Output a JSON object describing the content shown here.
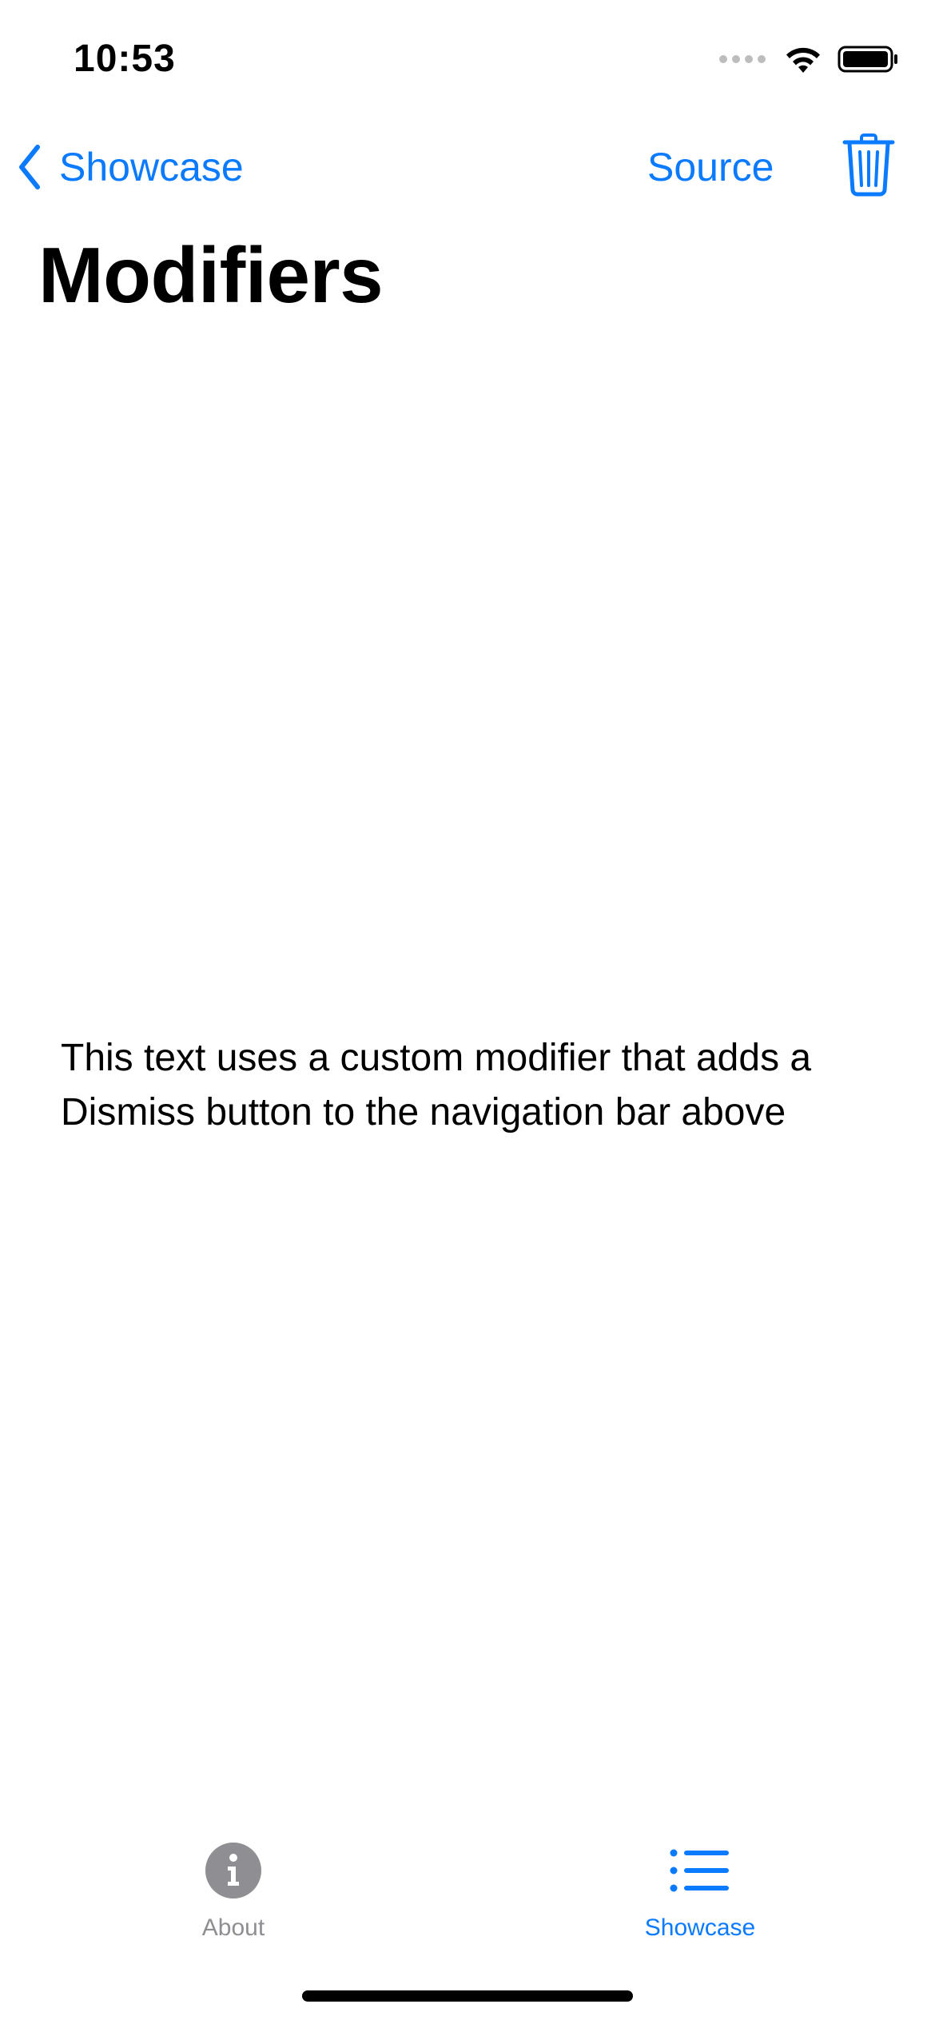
{
  "status_bar": {
    "time": "10:53"
  },
  "nav": {
    "back_label": "Showcase",
    "source_label": "Source"
  },
  "page": {
    "title": "Modifiers",
    "body_text": "This text uses a custom modifier that adds a Dismiss button to the navigation bar above"
  },
  "tab_bar": {
    "tabs": [
      {
        "label": "About",
        "icon": "info-circle-icon",
        "selected": false
      },
      {
        "label": "Showcase",
        "icon": "list-bullet-icon",
        "selected": true
      }
    ]
  },
  "colors": {
    "accent": "#0a7aff",
    "inactive": "#8e8e93",
    "background": "#ffffff",
    "text": "#000000"
  }
}
